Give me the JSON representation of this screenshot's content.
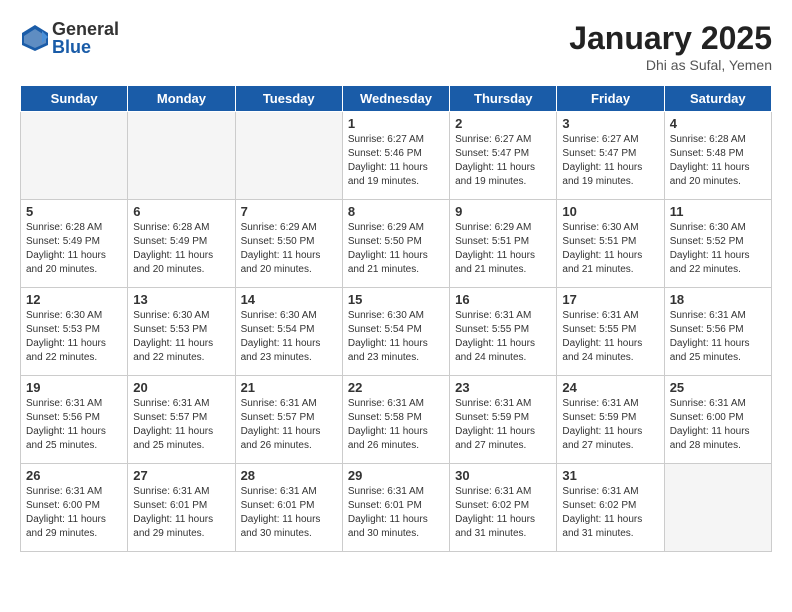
{
  "header": {
    "logo_general": "General",
    "logo_blue": "Blue",
    "title": "January 2025",
    "subtitle": "Dhi as Sufal, Yemen"
  },
  "weekdays": [
    "Sunday",
    "Monday",
    "Tuesday",
    "Wednesday",
    "Thursday",
    "Friday",
    "Saturday"
  ],
  "weeks": [
    [
      {
        "day": "",
        "info": ""
      },
      {
        "day": "",
        "info": ""
      },
      {
        "day": "",
        "info": ""
      },
      {
        "day": "1",
        "info": "Sunrise: 6:27 AM\nSunset: 5:46 PM\nDaylight: 11 hours and 19 minutes."
      },
      {
        "day": "2",
        "info": "Sunrise: 6:27 AM\nSunset: 5:47 PM\nDaylight: 11 hours and 19 minutes."
      },
      {
        "day": "3",
        "info": "Sunrise: 6:27 AM\nSunset: 5:47 PM\nDaylight: 11 hours and 19 minutes."
      },
      {
        "day": "4",
        "info": "Sunrise: 6:28 AM\nSunset: 5:48 PM\nDaylight: 11 hours and 20 minutes."
      }
    ],
    [
      {
        "day": "5",
        "info": "Sunrise: 6:28 AM\nSunset: 5:49 PM\nDaylight: 11 hours and 20 minutes."
      },
      {
        "day": "6",
        "info": "Sunrise: 6:28 AM\nSunset: 5:49 PM\nDaylight: 11 hours and 20 minutes."
      },
      {
        "day": "7",
        "info": "Sunrise: 6:29 AM\nSunset: 5:50 PM\nDaylight: 11 hours and 20 minutes."
      },
      {
        "day": "8",
        "info": "Sunrise: 6:29 AM\nSunset: 5:50 PM\nDaylight: 11 hours and 21 minutes."
      },
      {
        "day": "9",
        "info": "Sunrise: 6:29 AM\nSunset: 5:51 PM\nDaylight: 11 hours and 21 minutes."
      },
      {
        "day": "10",
        "info": "Sunrise: 6:30 AM\nSunset: 5:51 PM\nDaylight: 11 hours and 21 minutes."
      },
      {
        "day": "11",
        "info": "Sunrise: 6:30 AM\nSunset: 5:52 PM\nDaylight: 11 hours and 22 minutes."
      }
    ],
    [
      {
        "day": "12",
        "info": "Sunrise: 6:30 AM\nSunset: 5:53 PM\nDaylight: 11 hours and 22 minutes."
      },
      {
        "day": "13",
        "info": "Sunrise: 6:30 AM\nSunset: 5:53 PM\nDaylight: 11 hours and 22 minutes."
      },
      {
        "day": "14",
        "info": "Sunrise: 6:30 AM\nSunset: 5:54 PM\nDaylight: 11 hours and 23 minutes."
      },
      {
        "day": "15",
        "info": "Sunrise: 6:30 AM\nSunset: 5:54 PM\nDaylight: 11 hours and 23 minutes."
      },
      {
        "day": "16",
        "info": "Sunrise: 6:31 AM\nSunset: 5:55 PM\nDaylight: 11 hours and 24 minutes."
      },
      {
        "day": "17",
        "info": "Sunrise: 6:31 AM\nSunset: 5:55 PM\nDaylight: 11 hours and 24 minutes."
      },
      {
        "day": "18",
        "info": "Sunrise: 6:31 AM\nSunset: 5:56 PM\nDaylight: 11 hours and 25 minutes."
      }
    ],
    [
      {
        "day": "19",
        "info": "Sunrise: 6:31 AM\nSunset: 5:56 PM\nDaylight: 11 hours and 25 minutes."
      },
      {
        "day": "20",
        "info": "Sunrise: 6:31 AM\nSunset: 5:57 PM\nDaylight: 11 hours and 25 minutes."
      },
      {
        "day": "21",
        "info": "Sunrise: 6:31 AM\nSunset: 5:57 PM\nDaylight: 11 hours and 26 minutes."
      },
      {
        "day": "22",
        "info": "Sunrise: 6:31 AM\nSunset: 5:58 PM\nDaylight: 11 hours and 26 minutes."
      },
      {
        "day": "23",
        "info": "Sunrise: 6:31 AM\nSunset: 5:59 PM\nDaylight: 11 hours and 27 minutes."
      },
      {
        "day": "24",
        "info": "Sunrise: 6:31 AM\nSunset: 5:59 PM\nDaylight: 11 hours and 27 minutes."
      },
      {
        "day": "25",
        "info": "Sunrise: 6:31 AM\nSunset: 6:00 PM\nDaylight: 11 hours and 28 minutes."
      }
    ],
    [
      {
        "day": "26",
        "info": "Sunrise: 6:31 AM\nSunset: 6:00 PM\nDaylight: 11 hours and 29 minutes."
      },
      {
        "day": "27",
        "info": "Sunrise: 6:31 AM\nSunset: 6:01 PM\nDaylight: 11 hours and 29 minutes."
      },
      {
        "day": "28",
        "info": "Sunrise: 6:31 AM\nSunset: 6:01 PM\nDaylight: 11 hours and 30 minutes."
      },
      {
        "day": "29",
        "info": "Sunrise: 6:31 AM\nSunset: 6:01 PM\nDaylight: 11 hours and 30 minutes."
      },
      {
        "day": "30",
        "info": "Sunrise: 6:31 AM\nSunset: 6:02 PM\nDaylight: 11 hours and 31 minutes."
      },
      {
        "day": "31",
        "info": "Sunrise: 6:31 AM\nSunset: 6:02 PM\nDaylight: 11 hours and 31 minutes."
      },
      {
        "day": "",
        "info": ""
      }
    ]
  ]
}
